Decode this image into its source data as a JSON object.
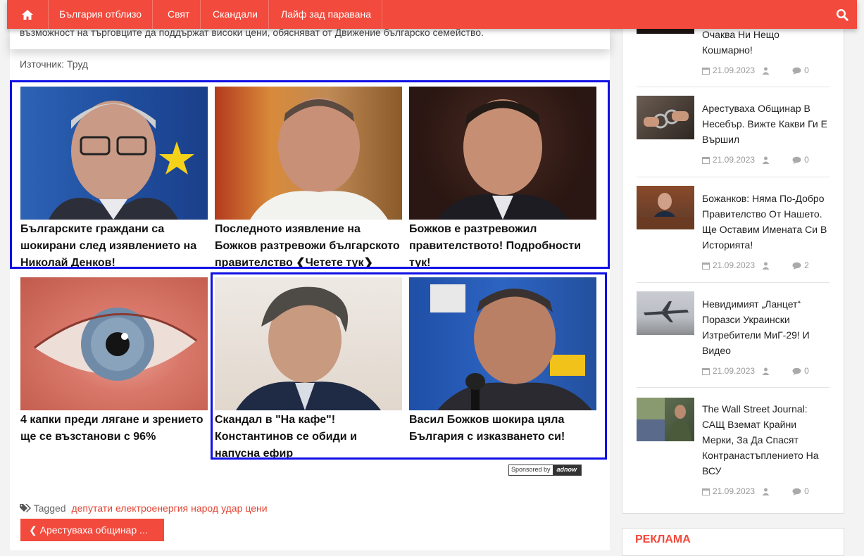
{
  "nav": {
    "items": [
      "България отблизо",
      "Свят",
      "Скандали",
      "Лайф зад паравана"
    ]
  },
  "article": {
    "intro_text": "възможност на търговците да поддържат високи цени, обясняват от Движение българско семейство.",
    "source": "Източник: Труд"
  },
  "ads": [
    {
      "caption": "Българските граждани са шокирани след изявлението на Николай Денков!"
    },
    {
      "caption": "Последното изявление на Божков разтревожи българското правителство ❮Четете тук❯"
    },
    {
      "caption": "Божков е разтревожил правителството! Подробности тук!"
    },
    {
      "caption": "4 капки преди лягане и зрението ще се възстанови с 96%"
    },
    {
      "caption": "Скандал в \"На кафе\"! Константинов се обиди и напусна ефир"
    },
    {
      "caption": "Васил Божков шокира цяла България с изказването си!"
    }
  ],
  "sponsored": {
    "label": "Sponsored by",
    "brand": "adnow"
  },
  "tags": {
    "label": "Tagged",
    "items": [
      "депутати",
      "електроенергия",
      "народ",
      "удар",
      "цени"
    ]
  },
  "prev_post": {
    "label": "❮ Арестуваха общинар ..."
  },
  "sidebar": {
    "items": [
      {
        "title": "Очаква Ни Нещо Кошмарно!",
        "date": "21.09.2023",
        "comments": "0"
      },
      {
        "title": "Арестуваха Общинар В Несебър. Вижте Какви Ги Е Вършил",
        "date": "21.09.2023",
        "comments": "0"
      },
      {
        "title": "Божанков: Няма По-Добро Правителство От Нашето. Ще Оставим Имената Си В Историята!",
        "date": "21.09.2023",
        "comments": "2"
      },
      {
        "title": "Невидимият „Ланцет“ Поразси Украински Изтребители МиГ-29! И Видео",
        "date": "21.09.2023",
        "comments": "0"
      },
      {
        "title": "The Wall Street Journal: САЩ Вземат Крайни Мерки, За Да Спасят Контранастъплението На ВСУ",
        "date": "21.09.2023",
        "comments": "0"
      }
    ],
    "reklama": "РЕКЛАМА"
  },
  "colors": {
    "accent": "#f24a3c",
    "highlight": "#1010e6"
  }
}
